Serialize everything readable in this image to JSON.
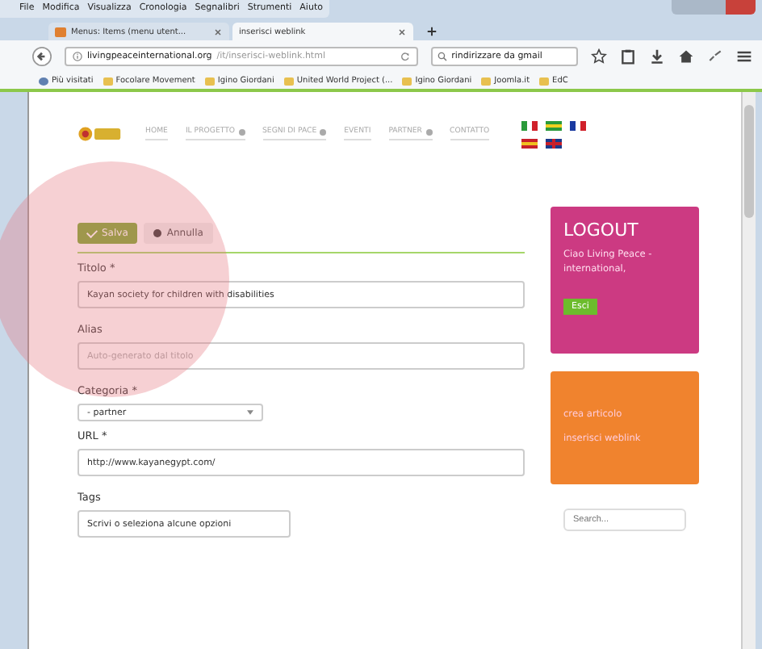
{
  "menu_bar": [
    "File",
    "Modifica",
    "Visualizza",
    "Cronologia",
    "Segnalibri",
    "Strumenti",
    "Aiuto"
  ],
  "tabs": [
    {
      "label": "Menus: Items (menu utent...",
      "selected": false
    },
    {
      "label": "inserisci weblink",
      "selected": true
    }
  ],
  "address_bar": {
    "host": "livingpeaceinternational.org",
    "path": "/it/inserisci-weblink.html"
  },
  "search_bar": {
    "value": "rindirizzare da gmail"
  },
  "bookmarks": [
    "Più visitati",
    "Focolare Movement",
    "Igino Giordani",
    "United World Project (...",
    "Igino Giordani",
    "Joomla.it",
    "EdC"
  ],
  "site_nav": [
    {
      "label": "HOME",
      "dropdown": false
    },
    {
      "label": "IL PROGETTO",
      "dropdown": true
    },
    {
      "label": "SEGNI DI PACE",
      "dropdown": true
    },
    {
      "label": "EVENTI",
      "dropdown": false
    },
    {
      "label": "PARTNER",
      "dropdown": true
    },
    {
      "label": "CONTATTO",
      "dropdown": false
    }
  ],
  "form": {
    "buttons": [
      {
        "kind": "save",
        "label": "Salva"
      },
      {
        "kind": "cancel",
        "label": "Annulla"
      }
    ],
    "fields": [
      {
        "kind": "text",
        "label": "Titolo *",
        "value": "Kayan society for children with disabilities"
      },
      {
        "kind": "text",
        "label": "Alias",
        "placeholder": "Auto-generato dal titolo"
      },
      {
        "kind": "select",
        "label": "Categoria *",
        "value": "- partner"
      },
      {
        "kind": "text",
        "label": "URL *",
        "value": "http://www.kayanegypt.com/"
      },
      {
        "kind": "short",
        "label": "Tags",
        "value": "Scrivi o seleziona alcune opzioni"
      }
    ]
  },
  "logout_panel": {
    "title": "LOGOUT",
    "greeting": "Ciao Living Peace - international,",
    "button": "Esci"
  },
  "user_menu": [
    "crea articolo",
    "inserisci weblink"
  ],
  "sidebar_search": {
    "placeholder": "Search..."
  }
}
